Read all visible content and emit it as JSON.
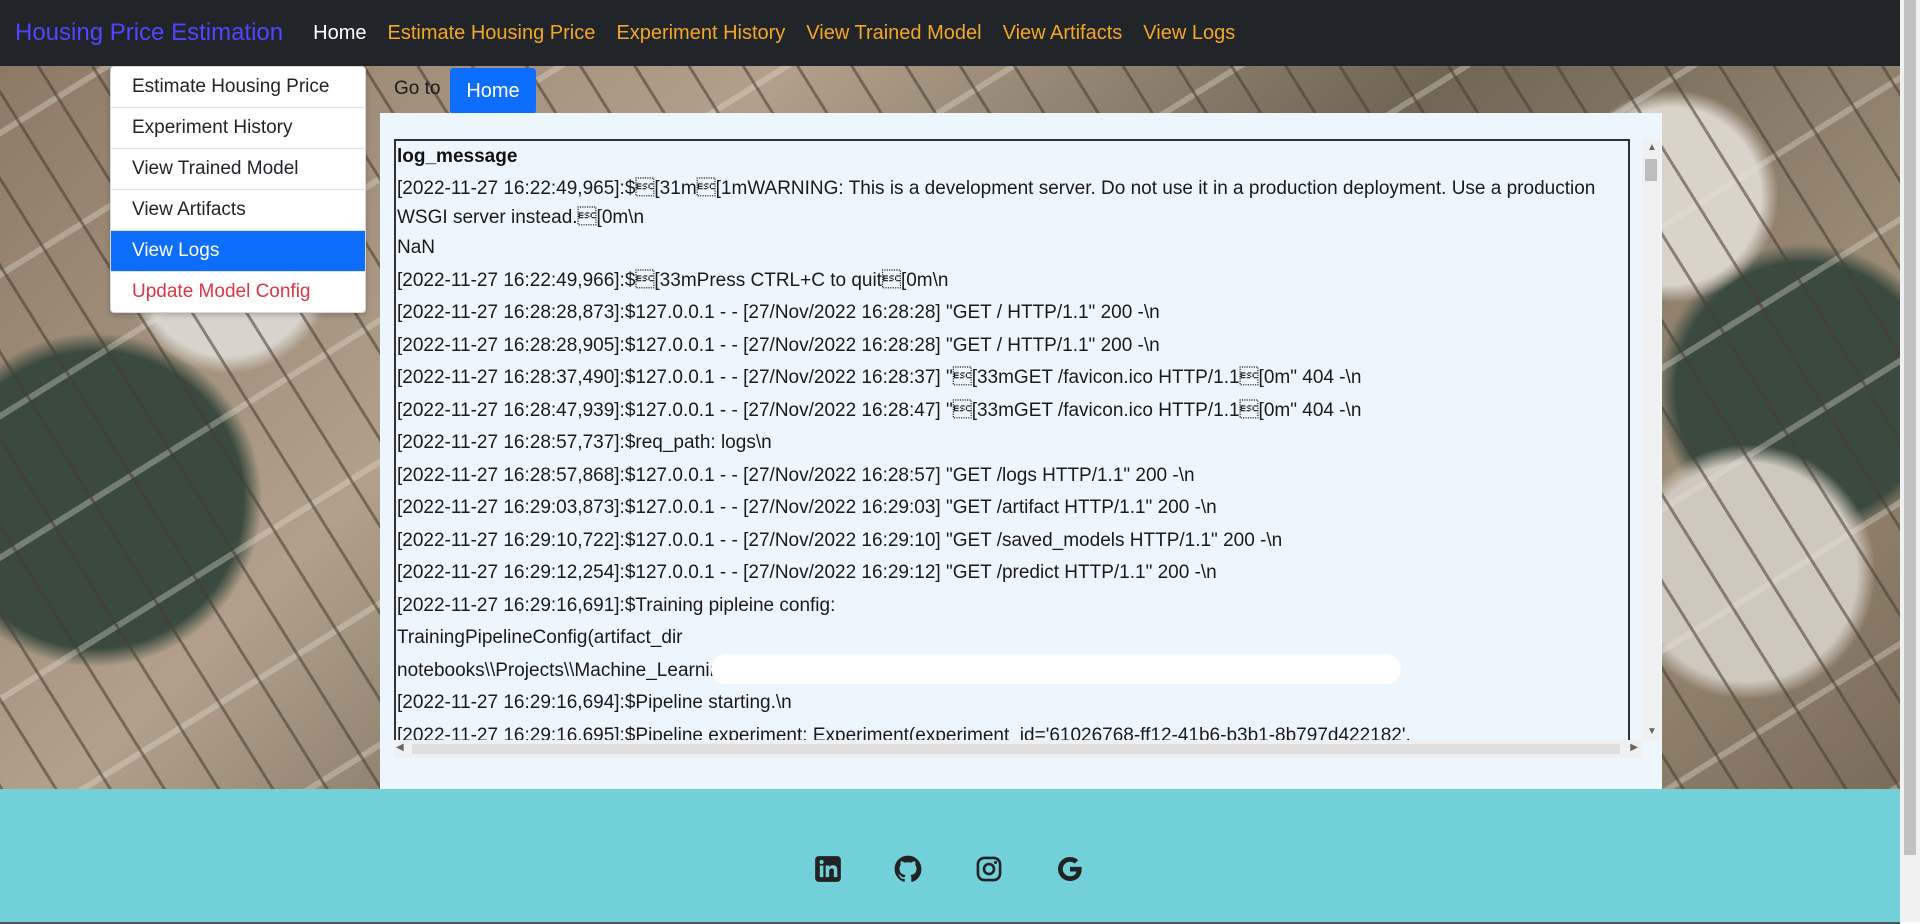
{
  "navbar": {
    "brand": "Housing Price Estimation",
    "links": [
      {
        "label": "Home",
        "active": true
      },
      {
        "label": "Estimate Housing Price"
      },
      {
        "label": "Experiment History"
      },
      {
        "label": "View Trained Model"
      },
      {
        "label": "View Artifacts"
      },
      {
        "label": "View Logs"
      }
    ]
  },
  "dropdown": {
    "items": [
      {
        "label": "Estimate Housing Price"
      },
      {
        "label": "Experiment History"
      },
      {
        "label": "View Trained Model"
      },
      {
        "label": "View Artifacts"
      },
      {
        "label": "View Logs",
        "selected": true
      },
      {
        "label": "Update Model Config",
        "danger": true
      }
    ]
  },
  "goto": {
    "label": "Go to",
    "button": "Home"
  },
  "log": {
    "header": "log_message",
    "lines": [
      "[2022-11-27 16:22:49,965]:$\u001b[31m\u001b[1mWARNING: This is a development server. Do not use it in a production deployment. Use a production WSGI server instead.\u001b[0m\\n",
      "NaN",
      "[2022-11-27 16:22:49,966]:$\u001b[33mPress CTRL+C to quit\u001b[0m\\n",
      "[2022-11-27 16:28:28,873]:$127.0.0.1 - - [27/Nov/2022 16:28:28] \"GET / HTTP/1.1\" 200 -\\n",
      "[2022-11-27 16:28:28,905]:$127.0.0.1 - - [27/Nov/2022 16:28:28] \"GET / HTTP/1.1\" 200 -\\n",
      "[2022-11-27 16:28:37,490]:$127.0.0.1 - - [27/Nov/2022 16:28:37] \"\u001b[33mGET /favicon.ico HTTP/1.1\u001b[0m\" 404 -\\n",
      "[2022-11-27 16:28:47,939]:$127.0.0.1 - - [27/Nov/2022 16:28:47] \"\u001b[33mGET /favicon.ico HTTP/1.1\u001b[0m\" 404 -\\n",
      "[2022-11-27 16:28:57,737]:$req_path: logs\\n",
      "[2022-11-27 16:28:57,868]:$127.0.0.1 - - [27/Nov/2022 16:28:57] \"GET /logs HTTP/1.1\" 200 -\\n",
      "[2022-11-27 16:29:03,873]:$127.0.0.1 - - [27/Nov/2022 16:29:03] \"GET /artifact HTTP/1.1\" 200 -\\n",
      "[2022-11-27 16:29:10,722]:$127.0.0.1 - - [27/Nov/2022 16:29:10] \"GET /saved_models HTTP/1.1\" 200 -\\n",
      "[2022-11-27 16:29:12,254]:$127.0.0.1 - - [27/Nov/2022 16:29:12] \"GET /predict HTTP/1.1\" 200 -\\n",
      "[2022-11-27 16:29:16,691]:$Training pipleine config:",
      "TrainingPipelineConfig(artifact_dir",
      "notebooks\\\\Projects\\\\Machine_Learning_project\\\\housing\\\\artifact')\\n",
      "[2022-11-27 16:29:16,694]:$Pipeline starting.\\n",
      "[2022-11-27 16:29:16,695]:$Pipeline experiment: Experiment(experiment_id='61026768-ff12-41b6-b3b1-8b797d422182',"
    ]
  },
  "footer": {
    "icons": [
      "linkedin-icon",
      "github-icon",
      "instagram-icon",
      "google-icon"
    ]
  }
}
